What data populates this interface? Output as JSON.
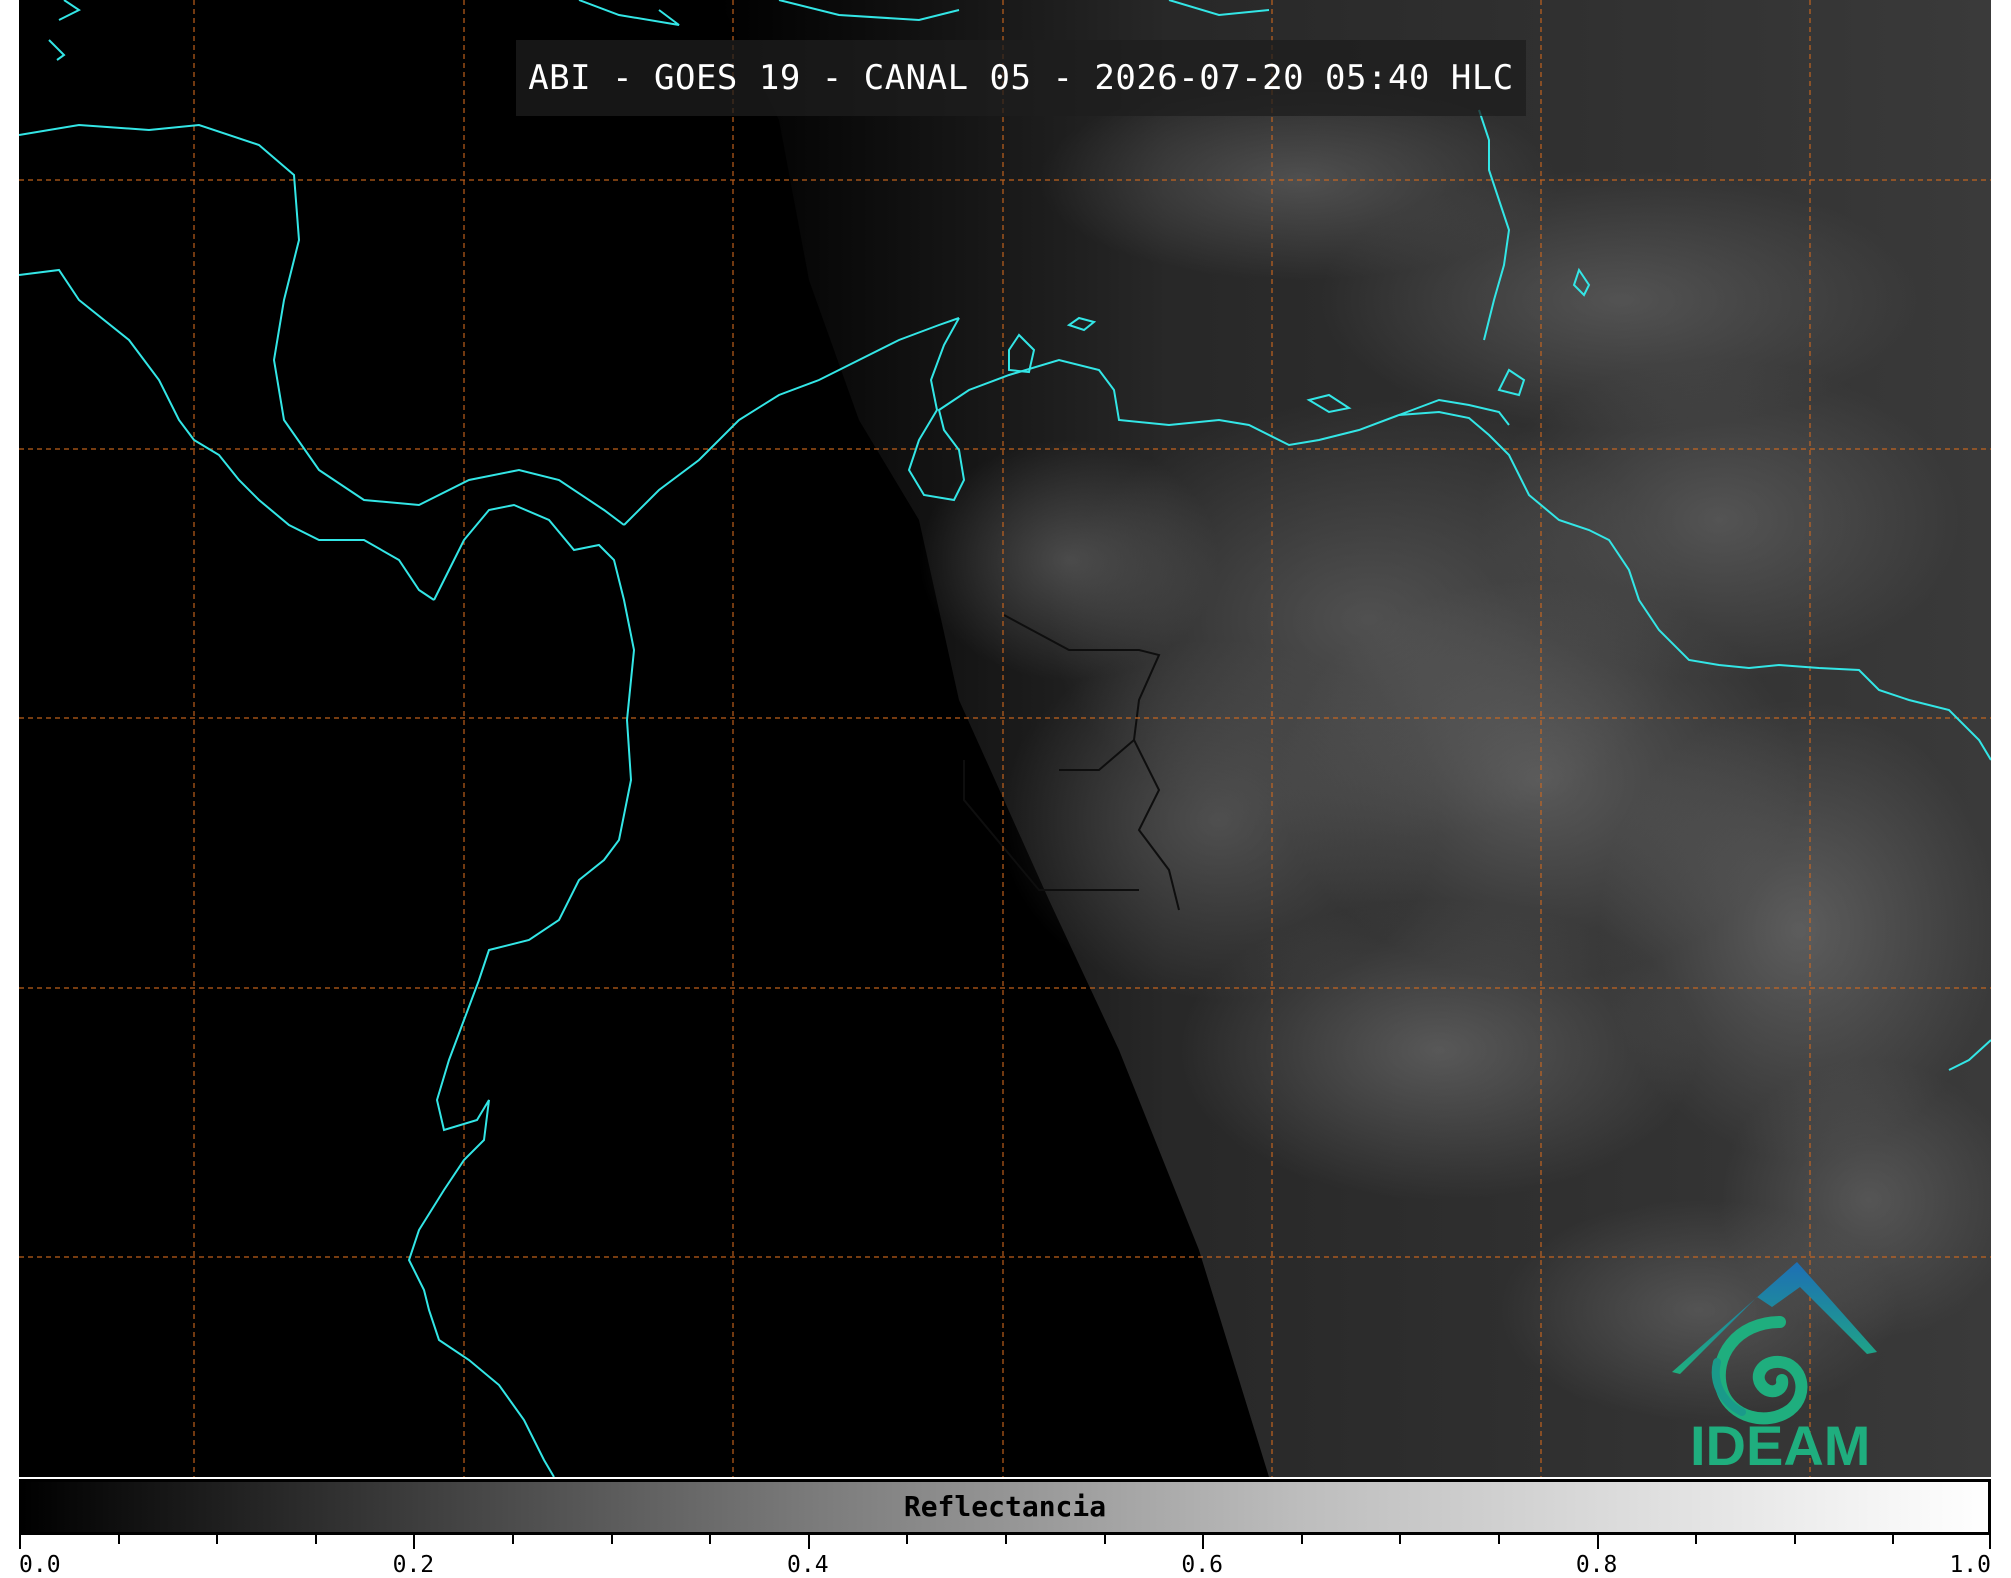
{
  "title": "ABI - GOES 19 - CANAL 05 - 2026-07-20 05:40 HLC",
  "logo": {
    "text": "IDEAM",
    "icon": "ideam-mountain-swirl-icon",
    "primary_color": "#1fae7e",
    "secondary_color": "#1e6fb5"
  },
  "colorbar": {
    "label": "Reflectancia",
    "min": 0.0,
    "max": 1.0,
    "ticks": [
      "0.0",
      "0.2",
      "0.4",
      "0.6",
      "0.8",
      "1.0"
    ],
    "minor_step": 0.05,
    "colormap": [
      "#000000",
      "#ffffff"
    ]
  },
  "map": {
    "coastline_color": "#33e6e6",
    "border_color": "#111111",
    "grid_color": "#d2691e",
    "grid_style": "dashed"
  }
}
